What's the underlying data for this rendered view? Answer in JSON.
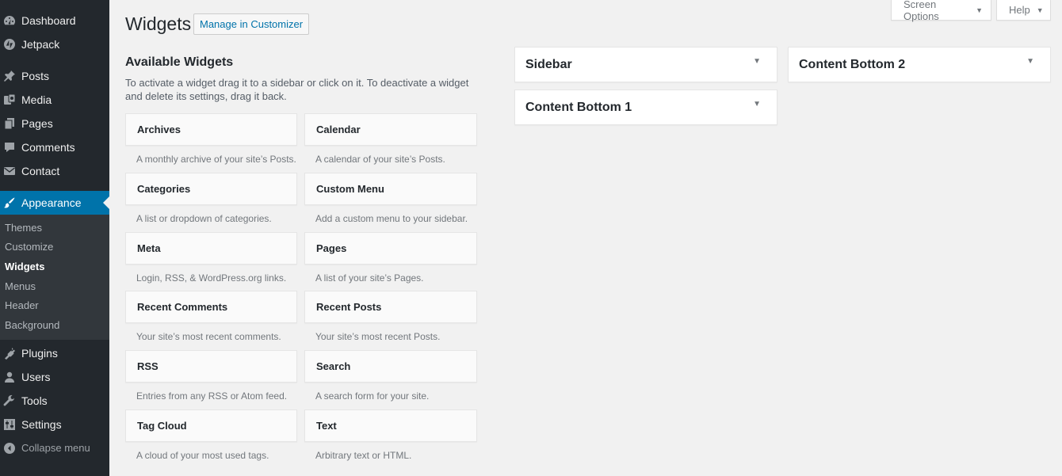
{
  "menu": {
    "items_top": [
      {
        "label": "Dashboard",
        "icon": "dashboard-icon"
      },
      {
        "label": "Jetpack",
        "icon": "jetpack-icon"
      },
      {
        "label": "Posts",
        "icon": "pushpin-icon"
      },
      {
        "label": "Media",
        "icon": "media-icon"
      },
      {
        "label": "Pages",
        "icon": "pages-icon"
      },
      {
        "label": "Comments",
        "icon": "comment-icon"
      },
      {
        "label": "Contact",
        "icon": "envelope-icon"
      },
      {
        "label": "Appearance",
        "icon": "paintbrush-icon"
      }
    ],
    "submenu": [
      {
        "label": "Themes"
      },
      {
        "label": "Customize"
      },
      {
        "label": "Widgets"
      },
      {
        "label": "Menus"
      },
      {
        "label": "Header"
      },
      {
        "label": "Background"
      }
    ],
    "items_bottom": [
      {
        "label": "Plugins",
        "icon": "plug-icon"
      },
      {
        "label": "Users",
        "icon": "users-icon"
      },
      {
        "label": "Tools",
        "icon": "wrench-icon"
      },
      {
        "label": "Settings",
        "icon": "sliders-icon"
      }
    ],
    "collapse_label": "Collapse menu"
  },
  "screen_meta": {
    "screen_options": "Screen Options",
    "help": "Help"
  },
  "header": {
    "title": "Widgets",
    "action": "Manage in Customizer"
  },
  "available": {
    "title": "Available Widgets",
    "description": "To activate a widget drag it to a sidebar or click on it. To deactivate a widget and delete its settings, drag it back.",
    "widgets": [
      {
        "name": "Archives",
        "desc": "A monthly archive of your site’s Posts."
      },
      {
        "name": "Calendar",
        "desc": "A calendar of your site’s Posts."
      },
      {
        "name": "Categories",
        "desc": "A list or dropdown of categories."
      },
      {
        "name": "Custom Menu",
        "desc": "Add a custom menu to your sidebar."
      },
      {
        "name": "Meta",
        "desc": "Login, RSS, & WordPress.org links."
      },
      {
        "name": "Pages",
        "desc": "A list of your site’s Pages."
      },
      {
        "name": "Recent Comments",
        "desc": "Your site’s most recent comments."
      },
      {
        "name": "Recent Posts",
        "desc": "Your site’s most recent Posts."
      },
      {
        "name": "RSS",
        "desc": "Entries from any RSS or Atom feed."
      },
      {
        "name": "Search",
        "desc": "A search form for your site."
      },
      {
        "name": "Tag Cloud",
        "desc": "A cloud of your most used tags."
      },
      {
        "name": "Text",
        "desc": "Arbitrary text or HTML."
      }
    ]
  },
  "sidebars": [
    {
      "name": "Sidebar"
    },
    {
      "name": "Content Bottom 1"
    },
    {
      "name": "Content Bottom 2"
    }
  ],
  "colors": {
    "menu_bg": "#23282d",
    "submenu_bg": "#32373c",
    "accent": "#0073aa",
    "page_bg": "#f1f1f1"
  }
}
